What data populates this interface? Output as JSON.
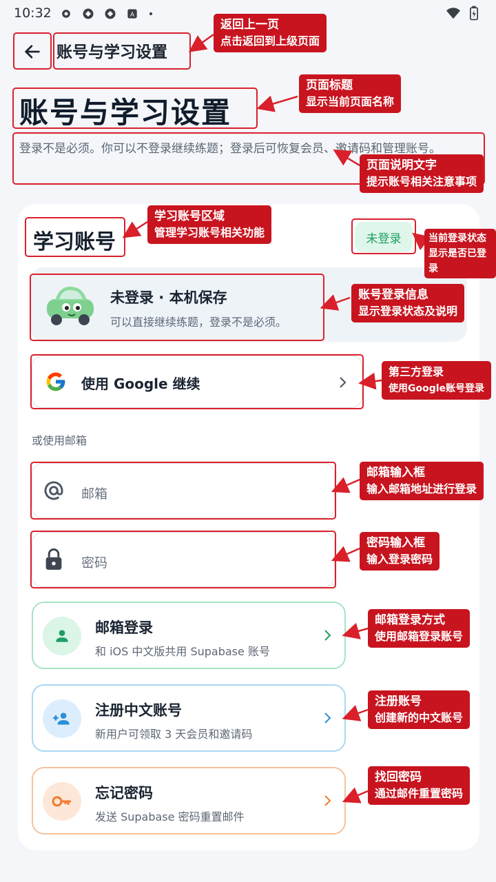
{
  "status_bar": {
    "time": "10:32"
  },
  "header": {
    "back_icon": "arrow-left-icon",
    "title": "账号与学习设置"
  },
  "page": {
    "title": "账号与学习设置",
    "description": "登录不是必须。你可以不登录继续练题；登录后可恢复会员、邀请码和管理账号。"
  },
  "account_section": {
    "title": "学习账号",
    "status_badge": "未登录",
    "account_card": {
      "title": "未登录 · 本机保存",
      "subtitle": "可以直接继续练题，登录不是必须。"
    },
    "google_button": "使用 Google 继续",
    "or_email_label": "或使用邮箱",
    "email_placeholder": "邮箱",
    "password_placeholder": "密码",
    "options": [
      {
        "title": "邮箱登录",
        "subtitle": "和 iOS 中文版共用 Supabase 账号",
        "icon": "person-icon",
        "color": "#1f9d63"
      },
      {
        "title": "注册中文账号",
        "subtitle": "新用户可领取 3 天会员和邀请码",
        "icon": "person-add-icon",
        "color": "#2b8fd6"
      },
      {
        "title": "忘记密码",
        "subtitle": "发送 Supabase 密码重置邮件",
        "icon": "key-icon",
        "color": "#f07a2e"
      }
    ]
  },
  "annotations": {
    "back": {
      "line1": "返回上一页",
      "line2": "点击返回到上级页面"
    },
    "title": {
      "line1": "页面标题",
      "line2": "显示当前页面名称"
    },
    "desc": {
      "line1": "页面说明文字",
      "line2": "提示账号相关注意事项"
    },
    "section": {
      "line1": "学习账号区域",
      "line2": "管理学习账号相关功能"
    },
    "status": {
      "line1": "当前登录状态",
      "line2": "显示是否已登录"
    },
    "account": {
      "line1": "账号登录信息",
      "line2": "显示登录状态及说明"
    },
    "google": {
      "line1": "第三方登录",
      "line2": "使用Google账号登录"
    },
    "email": {
      "line1": "邮箱输入框",
      "line2": "输入邮箱地址进行登录"
    },
    "password": {
      "line1": "密码输入框",
      "line2": "输入登录密码"
    },
    "email_login": {
      "line1": "邮箱登录方式",
      "line2": "使用邮箱登录账号"
    },
    "register": {
      "line1": "注册账号",
      "line2": "创建新的中文账号"
    },
    "forgot": {
      "line1": "找回密码",
      "line2": "通过邮件重置密码"
    }
  }
}
